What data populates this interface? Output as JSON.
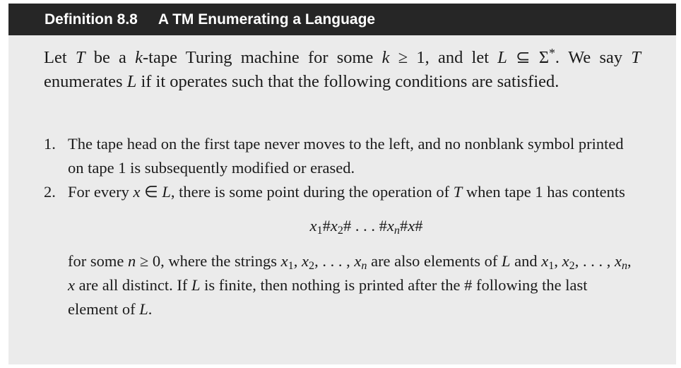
{
  "definition": {
    "label": "Definition 8.8",
    "title": "A TM Enumerating a Language"
  },
  "intro": {
    "p1": "Let ",
    "T": "T",
    "p2": " be a ",
    "k": "k",
    "p3": "-tape Turing machine for some ",
    "k2": "k",
    "p4": " ≥ 1, and let ",
    "L": "L",
    "p5": " ⊆ Σ",
    "star": "*",
    "p6": ". We say ",
    "T2": "T",
    "p7": " enumerates ",
    "L2": "L",
    "p8": " if it operates such that the following conditions are satisfied."
  },
  "items": [
    {
      "num": "1.",
      "text": "The tape head on the first tape never moves to the left, and no nonblank symbol printed on tape 1 is subsequently modified or erased."
    },
    {
      "num": "2.",
      "a": "For every ",
      "x": "x",
      "b": " ∈ ",
      "L": "L",
      "c": ", there is some point during the operation of ",
      "T": "T",
      "d": " when tape 1 has contents",
      "formula": {
        "x1": "x",
        "s1": "1",
        "h1": "#",
        "x2": "x",
        "s2": "2",
        "h2": "#",
        "dots": " . . . ",
        "h3": "#",
        "xn": "x",
        "sn": "n",
        "h4": "#",
        "x": "x",
        "h5": "#"
      },
      "t1": "for some ",
      "n": "n",
      "t2": " ≥ 0, where the strings ",
      "x1": "x",
      "s1": "1",
      "t3": ", ",
      "x2": "x",
      "s2": "2",
      "t4": ", . . . , ",
      "xn": "x",
      "sn": "n",
      "t5": " are also elements of ",
      "L2": "L",
      "t6": " and ",
      "y1": "x",
      "r1": "1",
      "t7": ", ",
      "y2": "x",
      "r2": "2",
      "t8": ", . . . , ",
      "yn": "x",
      "rn": "n",
      "t9": ", ",
      "y": "x",
      "t10": " are all distinct. If ",
      "L3": "L",
      "t11": " is finite, then nothing is printed after the # following the last element of ",
      "L4": "L",
      "t12": "."
    }
  ]
}
